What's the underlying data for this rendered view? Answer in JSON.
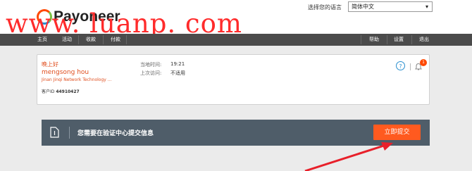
{
  "brand": {
    "name": "Payoneer",
    "logo_colors": [
      "#ff4800",
      "#7ac143",
      "#2a8fcf"
    ]
  },
  "watermark": {
    "text": "www. luanp. com",
    "color": "#ff2b2b"
  },
  "language": {
    "label": "选择您的语言",
    "selected": "简体中文"
  },
  "nav": {
    "left": [
      {
        "label": "主页"
      },
      {
        "label": "活动"
      },
      {
        "label": "收款"
      },
      {
        "label": "付款"
      }
    ],
    "right": [
      {
        "label": "帮助"
      },
      {
        "label": "设置"
      },
      {
        "label": "退出"
      }
    ]
  },
  "account": {
    "greeting": "晚上好",
    "user_name": "mengsong hou",
    "company": "Jinan Jinqi Network Technology ...",
    "customer_id_label": "客户ID",
    "customer_id": "44910427",
    "local_time_label": "当地时间:",
    "local_time": "19:21",
    "last_visit_label": "上次访问:",
    "last_visit": "不适用",
    "notification_count": "1"
  },
  "banner": {
    "text": "您需要在验证中心提交信息",
    "button": "立即提交",
    "button_color": "#ff5a1f"
  },
  "colors": {
    "accent": "#ff4800",
    "nav_bg": "#4b4b4b",
    "banner_bg": "#4f5d69",
    "annotation_arrow": "#e8202a"
  }
}
